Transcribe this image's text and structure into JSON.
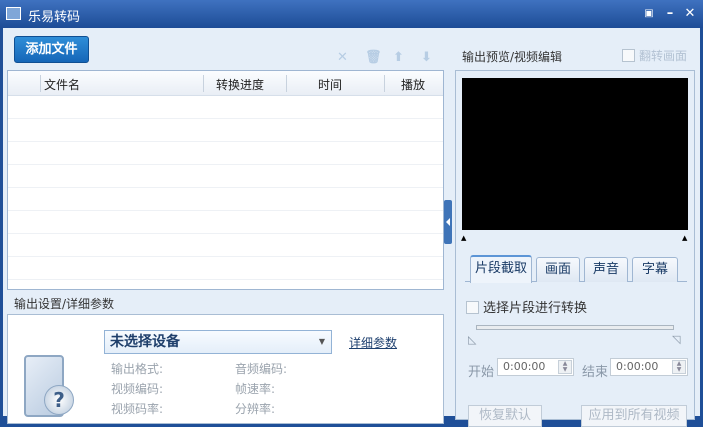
{
  "window": {
    "title": "乐易转码",
    "menu_icon": "dropdown-icon",
    "minimize": "minimize-icon",
    "close": "close-icon"
  },
  "toolbar": {
    "add_file": "添加文件",
    "icons": [
      "remove-icon",
      "trash-icon",
      "move-up-icon",
      "move-down-icon"
    ]
  },
  "file_list": {
    "columns": [
      "文件名",
      "转换进度",
      "时间",
      "播放"
    ],
    "rows": []
  },
  "preview": {
    "label": "输出预览/视频编辑",
    "flip_label": "翻转画面",
    "flip_checked": false
  },
  "tabs": [
    {
      "label": "片段截取",
      "active": true
    },
    {
      "label": "画面"
    },
    {
      "label": "声音"
    },
    {
      "label": "字幕"
    }
  ],
  "clip": {
    "checkbox_label": "选择片段进行转换",
    "start_label": "开始",
    "start_value": "0:00:00",
    "end_label": "结束",
    "end_value": "0:00:00"
  },
  "buttons": {
    "reset": "恢复默认",
    "apply_all": "应用到所有视频"
  },
  "output": {
    "label": "输出设置/详细参数",
    "device": "未选择设备",
    "detail_link": "详细参数",
    "params": [
      "输出格式:",
      "音频编码:",
      "视频编码:",
      "帧速率:",
      "视频码率:",
      "分辨率:"
    ]
  }
}
